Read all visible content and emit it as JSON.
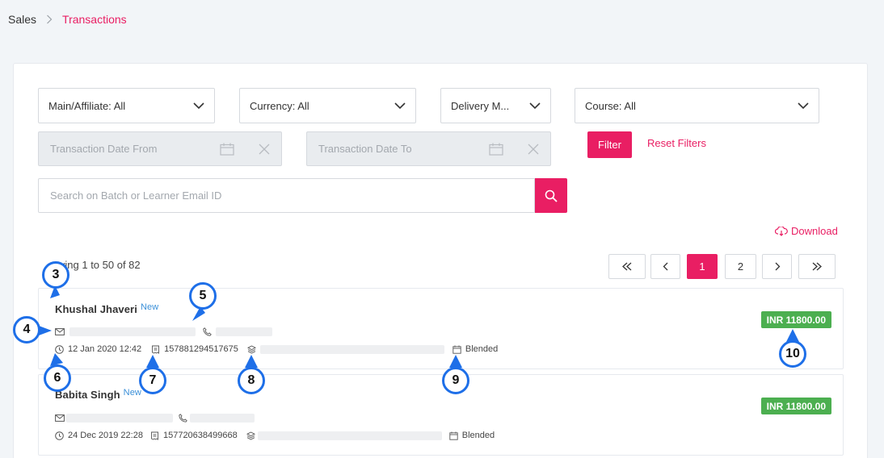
{
  "breadcrumb": {
    "root": "Sales",
    "current": "Transactions"
  },
  "filters": {
    "main_affiliate": "Main/Affiliate: All",
    "currency": "Currency: All",
    "delivery": "Delivery M...",
    "course": "Course: All",
    "date_from_placeholder": "Transaction Date From",
    "date_to_placeholder": "Transaction Date To",
    "filter_label": "Filter",
    "reset_label": "Reset Filters"
  },
  "search": {
    "placeholder": "Search on Batch or Learner Email ID"
  },
  "download_label": "Download",
  "showing_text": "wing 1 to 50 of 82",
  "pagination": {
    "first": "«",
    "prev": "‹",
    "pages": [
      "1",
      "2"
    ],
    "current": "1",
    "next": "›",
    "last": "»"
  },
  "transactions": [
    {
      "name": "Khushal Jhaveri",
      "tag": "New",
      "datetime": "12 Jan 2020 12:42",
      "txn_id": "157881294517675",
      "mode": "Blended",
      "amount": "INR 11800.00"
    },
    {
      "name": "Babita Singh",
      "tag": "New",
      "datetime": "24 Dec 2019 22:28",
      "txn_id": "157720638499668",
      "mode": "Blended",
      "amount": "INR 11800.00"
    }
  ],
  "markers": [
    "3",
    "4",
    "5",
    "6",
    "7",
    "8",
    "9",
    "10"
  ],
  "colors": {
    "accent": "#e91e63",
    "amount_bg": "#4caf50",
    "marker_ring": "#1e6fe8",
    "new_tag": "#3a8fd8"
  }
}
